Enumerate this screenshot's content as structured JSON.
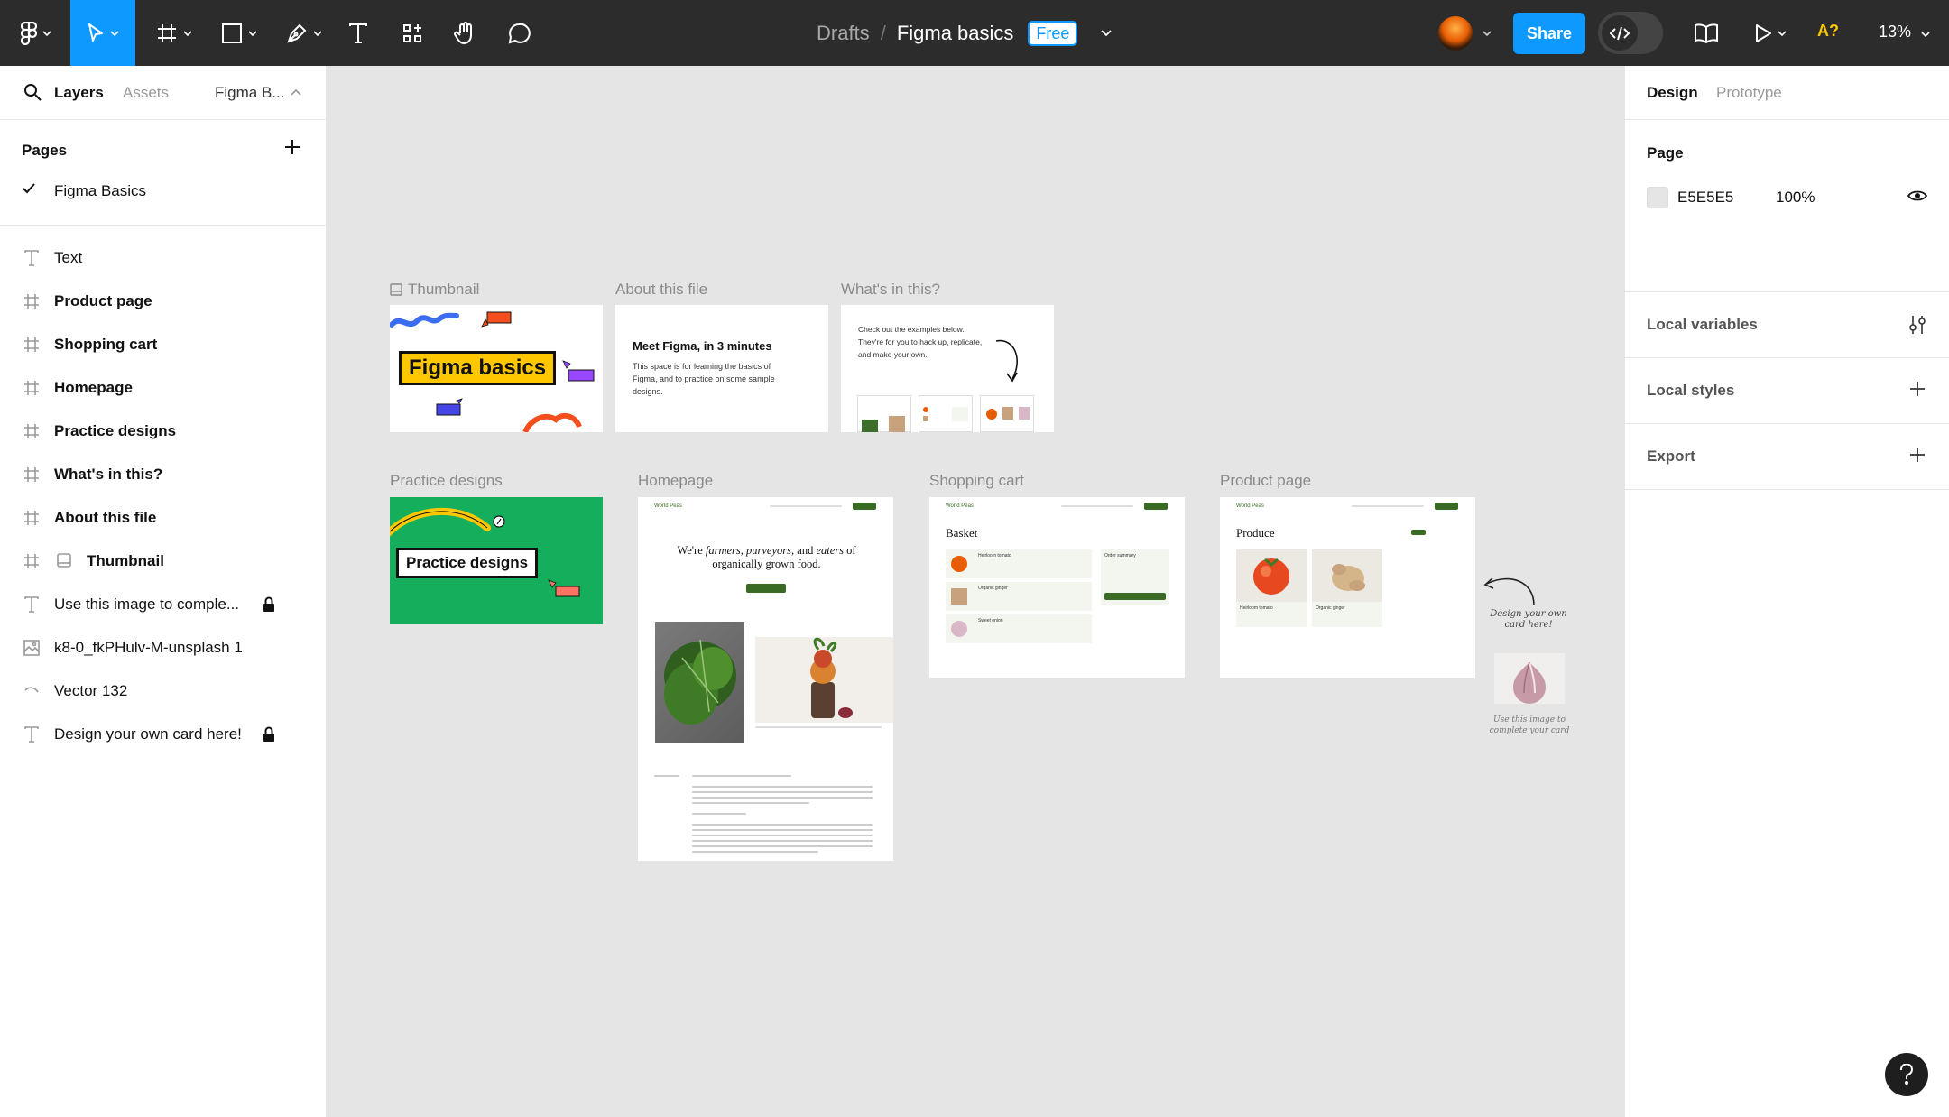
{
  "toolbar": {
    "breadcrumb_root": "Drafts",
    "breadcrumb_sep": "/",
    "file_title": "Figma basics",
    "plan_badge": "Free",
    "share_label": "Share",
    "ai_label": "A?",
    "zoom_label": "13%"
  },
  "left_panel": {
    "tabs": {
      "layers": "Layers",
      "assets": "Assets",
      "file_name": "Figma B..."
    },
    "pages_header": "Pages",
    "pages": [
      {
        "label": "Figma Basics",
        "selected": true
      }
    ],
    "layers": [
      {
        "label": "Text",
        "icon": "text-icon",
        "bold": false
      },
      {
        "label": "Product page",
        "icon": "frame-icon",
        "bold": true
      },
      {
        "label": "Shopping cart",
        "icon": "frame-icon",
        "bold": true
      },
      {
        "label": "Homepage",
        "icon": "frame-icon",
        "bold": true
      },
      {
        "label": "Practice designs",
        "icon": "frame-icon",
        "bold": true
      },
      {
        "label": "What's in this?",
        "icon": "frame-icon",
        "bold": true
      },
      {
        "label": "About this file",
        "icon": "frame-icon",
        "bold": true
      },
      {
        "label": "Thumbnail",
        "icon": "frame-icon",
        "bold": true
      },
      {
        "label": "Use this image to comple...",
        "icon": "text-icon",
        "bold": false,
        "locked": true
      },
      {
        "label": "k8-0_fkPHulv-M-unsplash 1",
        "icon": "image-icon",
        "bold": false
      },
      {
        "label": "Vector 132",
        "icon": "vector-icon",
        "bold": false
      },
      {
        "label": "Design your own card here!",
        "icon": "text-icon",
        "bold": false,
        "locked": true
      }
    ]
  },
  "right_panel": {
    "tabs": {
      "design": "Design",
      "prototype": "Prototype"
    },
    "page_header": "Page",
    "page_fill_hex": "E5E5E5",
    "page_fill_opacity": "100%",
    "sections": [
      {
        "label": "Local variables",
        "action_icon": "sliders-icon"
      },
      {
        "label": "Local styles",
        "action_icon": "plus-icon"
      },
      {
        "label": "Export",
        "action_icon": "plus-icon"
      }
    ]
  },
  "canvas": {
    "frames": {
      "thumbnail": {
        "label": "Thumbnail",
        "title": "Figma basics"
      },
      "about": {
        "label": "About this file",
        "heading": "Meet Figma, in 3 minutes",
        "body": "This space is for learning the basics of Figma, and to practice on some sample designs."
      },
      "whats": {
        "label": "What's in this?",
        "body": "Check out the examples below. They're for you to hack up, replicate, and make your own."
      },
      "practice": {
        "label": "Practice designs",
        "title": "Practice designs"
      },
      "homepage": {
        "label": "Homepage",
        "brand": "World Peas",
        "hero_a": "We're ",
        "hero_em1": "farmers, purveyors,",
        "hero_b": " and ",
        "hero_em2": "eaters",
        "hero_c": " of organically grown food."
      },
      "cart": {
        "label": "Shopping cart",
        "brand": "World Peas",
        "heading": "Basket",
        "summary": "Order summary",
        "items": [
          "Heirloom tomato",
          "Organic ginger",
          "Sweet onion"
        ]
      },
      "product": {
        "label": "Product page",
        "brand": "World Peas",
        "heading": "Produce",
        "items": [
          "Heirloom tomato",
          "Organic ginger"
        ]
      }
    },
    "card_note": "Design your own card here!",
    "image_note": "Use this image to complete your card"
  },
  "colors": {
    "accent": "#0d99ff",
    "toolbar_bg": "#2c2c2c",
    "canvas_bg": "#e5e5e5",
    "practice_green": "#14ae5c",
    "thumb_yellow": "#ffc700"
  }
}
